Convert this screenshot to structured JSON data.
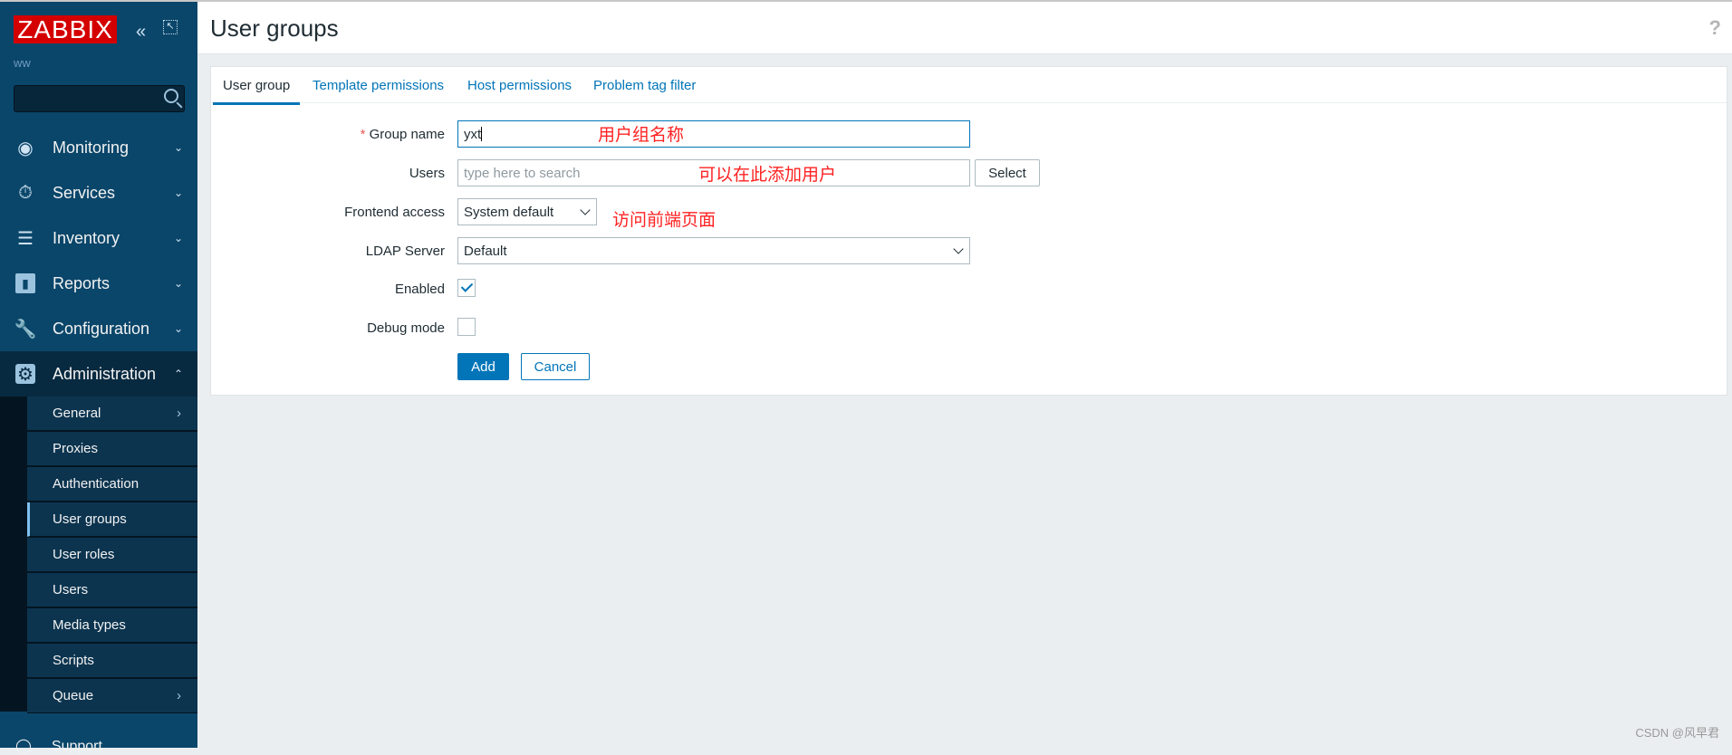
{
  "sidebar": {
    "logo": "ZABBIX",
    "server_name": "ww",
    "search_placeholder": "",
    "menu": [
      {
        "label": "Monitoring",
        "icon": "eye-icon"
      },
      {
        "label": "Services",
        "icon": "stopwatch-icon"
      },
      {
        "label": "Inventory",
        "icon": "list-icon"
      },
      {
        "label": "Reports",
        "icon": "bar-chart-icon"
      },
      {
        "label": "Configuration",
        "icon": "wrench-icon"
      },
      {
        "label": "Administration",
        "icon": "gear-icon",
        "expanded": true
      }
    ],
    "submenu": [
      "General",
      "Proxies",
      "Authentication",
      "User groups",
      "User roles",
      "Users",
      "Media types",
      "Scripts",
      "Queue"
    ],
    "selected_submenu": "User groups",
    "support": "Support"
  },
  "header": {
    "title": "User groups",
    "help": "?"
  },
  "tabs": [
    "User group",
    "Template permissions",
    "Host permissions",
    "Problem tag filter"
  ],
  "form": {
    "group_name_label": "Group name",
    "group_name_value": "yxt",
    "users_label": "Users",
    "users_placeholder": "type here to search",
    "select_button": "Select",
    "frontend_label": "Frontend access",
    "frontend_value": "System default",
    "ldap_label": "LDAP Server",
    "ldap_value": "Default",
    "enabled_label": "Enabled",
    "enabled": true,
    "debug_label": "Debug mode",
    "debug": false,
    "add_button": "Add",
    "cancel_button": "Cancel"
  },
  "annotations": {
    "group_name": "用户组名称",
    "users": "可以在此添加用户",
    "frontend": "访问前端页面"
  },
  "footer": "CSDN @风早君",
  "colors": {
    "sidebar": "#0a466a",
    "accent": "#0275b8",
    "logo": "#d40000",
    "annotation": "#ff2222"
  }
}
